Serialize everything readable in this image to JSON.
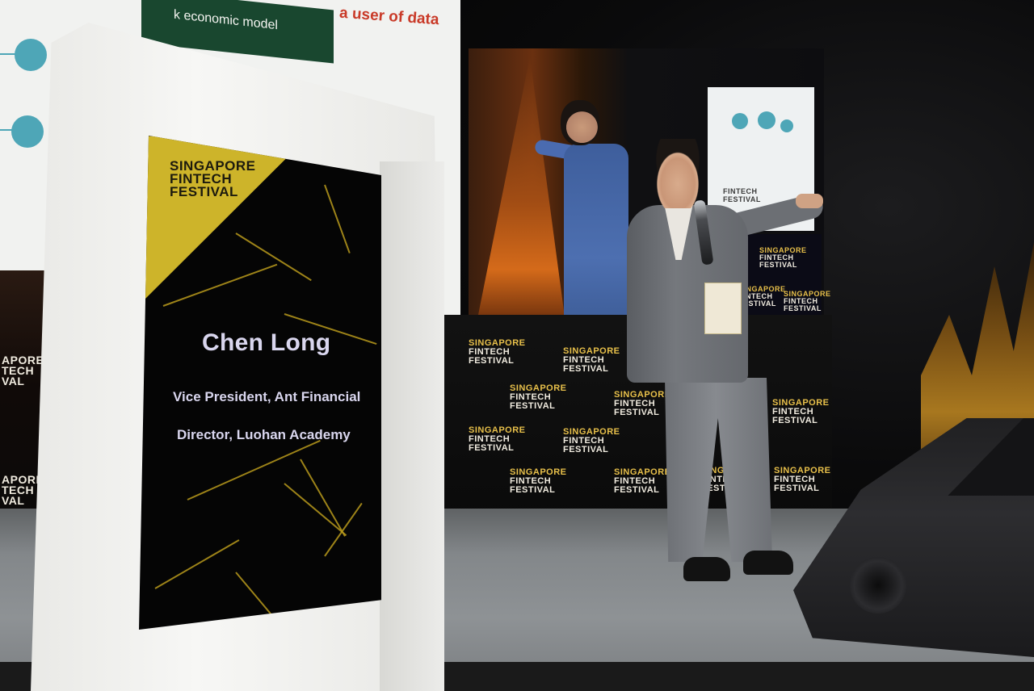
{
  "slide": {
    "banner_text": "k economic model",
    "red_text": "a user of data"
  },
  "festival_logo": {
    "line1": "SINGAPORE",
    "line2": "FINTECH",
    "line3": "FESTIVAL"
  },
  "podium_display": {
    "name": "Chen Long",
    "title_1": "Vice President, Ant Financial",
    "title_2": "Director, Luohan Academy"
  },
  "imag_logo": {
    "line1": "FINTECH",
    "line2": "FESTIVAL"
  },
  "left_strip": {
    "top": [
      "APORE",
      "TECH",
      "VAL"
    ],
    "bottom": [
      "APORE",
      "TECH",
      "VAL"
    ]
  },
  "colors": {
    "slide_green": "#19472f",
    "slide_red": "#c93a28",
    "logo_gold": "#cdb42a",
    "podium_text": "#d9d6ee"
  }
}
